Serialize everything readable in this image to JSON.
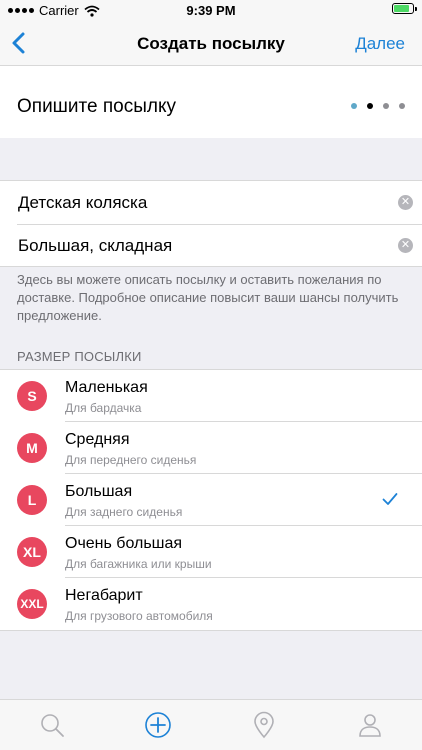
{
  "status_bar": {
    "carrier": "Carrier",
    "time": "9:39 PM"
  },
  "nav": {
    "back_icon": "chevron-left-icon",
    "title": "Создать посылку",
    "next_label": "Далее",
    "accent": "#1d82d6"
  },
  "header": {
    "title": "Опишите посылку",
    "pager": {
      "pages": 4,
      "current": 2,
      "colors": [
        "#5fa8c9",
        "#000000",
        "#8e8e93",
        "#8e8e93"
      ]
    }
  },
  "description": {
    "line1": {
      "value": "Детская коляска",
      "placeholder": ""
    },
    "line2": {
      "value": "Большая, складная",
      "placeholder": ""
    },
    "clear_icon": "clear-icon",
    "help_text": "Здесь вы можете описать посылку и оставить пожелания по доставке. Подробное описание повысит ваши шансы получить предложение."
  },
  "size_section": {
    "label": "РАЗМЕР ПОСЫЛКИ",
    "badge_color": "#e8475f",
    "items": [
      {
        "badge": "S",
        "title": "Маленькая",
        "subtitle": "Для бардачка",
        "selected": false
      },
      {
        "badge": "M",
        "title": "Средняя",
        "subtitle": "Для переднего сиденья",
        "selected": false
      },
      {
        "badge": "L",
        "title": "Большая",
        "subtitle": "Для заднего сиденья",
        "selected": true
      },
      {
        "badge": "XL",
        "title": "Очень большая",
        "subtitle": "Для багажника или крыши",
        "selected": false
      },
      {
        "badge": "XXL",
        "title": "Негабарит",
        "subtitle": "Для грузового автомобиля",
        "selected": false
      }
    ]
  },
  "tab_bar": {
    "tabs": [
      {
        "icon": "search-icon",
        "active": false
      },
      {
        "icon": "add-circle-icon",
        "active": true
      },
      {
        "icon": "location-pin-icon",
        "active": false
      },
      {
        "icon": "profile-icon",
        "active": false
      }
    ]
  }
}
